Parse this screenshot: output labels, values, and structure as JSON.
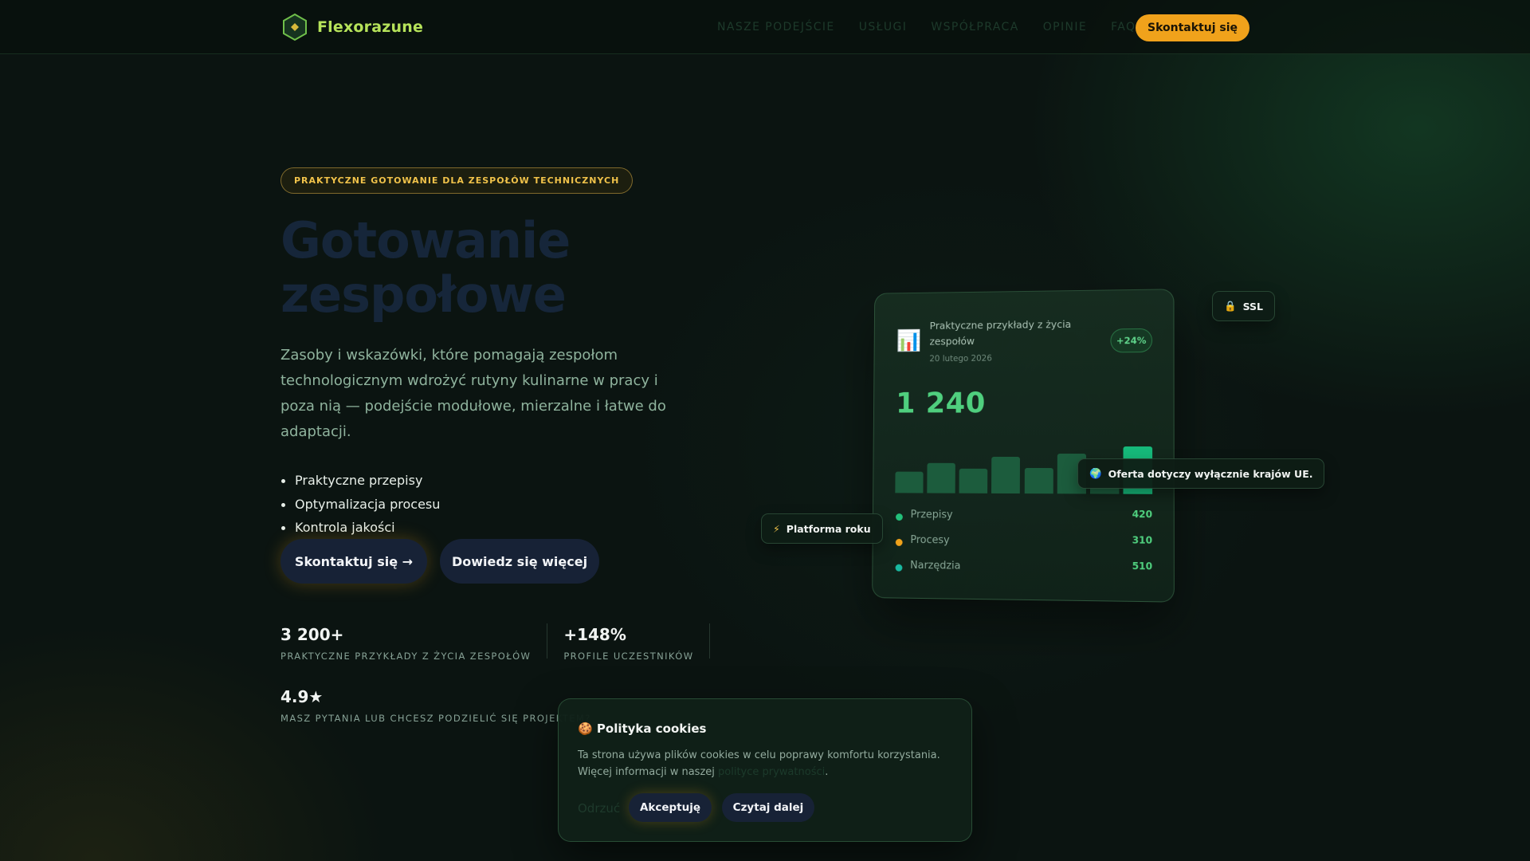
{
  "nav": {
    "logo_text": "Flexorazune",
    "links": [
      "NASZE PODEJŚCIE",
      "USŁUGI",
      "WSPÓŁPRACA",
      "OPINIE",
      "FAQ"
    ],
    "cta": "Skontaktuj się"
  },
  "hero": {
    "badge": "PRAKTYCZNE GOTOWANIE DLA ZESPOŁÓW TECHNICZNYCH",
    "title": "Gotowanie zespołowe",
    "subtitle": "Zasoby i wskazówki, które pomagają zespołom technologicznym wdrożyć rutyny kulinarne w pracy i poza nią — podejście modułowe, mierzalne i łatwe do adaptacji.",
    "bullets": [
      "Praktyczne przepisy",
      "Optymalizacja procesu",
      "Kontrola jakości"
    ],
    "primary_btn": "Skontaktuj się →",
    "secondary_btn": "Dowiedz się więcej"
  },
  "stats": [
    {
      "value": "3 200+",
      "label": "PRAKTYCZNE PRZYKŁADY Z ŻYCIA ZESPOŁÓW"
    },
    {
      "value": "+148%",
      "label": "PROFILE UCZESTNIKÓW"
    },
    {
      "value": "4.9★",
      "label": "MASZ PYTANIA LUB CHCESZ PODZIELIĆ SIĘ PROJEKTEM?"
    }
  ],
  "card": {
    "icon": "bar-chart-icon",
    "title": "Praktyczne przykłady z życia zespołów",
    "date": "20 lutego 2026",
    "pill": "+24%",
    "big_value": "1 240",
    "bar_levels": [
      0.42,
      0.6,
      0.48,
      0.72,
      0.5,
      0.78,
      0.35,
      0.92
    ],
    "bar_colors": {
      "normal": "#1c5c3d",
      "highlight": "#16b97a"
    },
    "legend": [
      {
        "label": "Przepisy",
        "value": "420",
        "color": "#23c07a"
      },
      {
        "label": "Procesy",
        "value": "310",
        "color": "#f0a21b"
      },
      {
        "label": "Narzędzia",
        "value": "510",
        "color": "#19b8a0"
      }
    ]
  },
  "chips": {
    "ssl": {
      "icon": "lock-icon",
      "text": "SSL"
    },
    "eu": {
      "icon": "globe-icon",
      "text": "Oferta dotyczy wyłącznie krajów UE."
    },
    "platform": {
      "icon": "lightning-icon",
      "text": "Platforma roku"
    }
  },
  "cookie": {
    "title": "🍪 Polityka cookies",
    "text_before": "Ta strona używa plików cookies w celu poprawy komfortu korzystania. Więcej informacji w naszej ",
    "link": "polityce prywatności",
    "text_after": ".",
    "reject": "Odrzuć",
    "accept": "Akceptuję",
    "more": "Czytaj dalej"
  },
  "colors": {
    "accent": "#f0a21b",
    "brand": "#b6e35a",
    "positive": "#4fcf7e"
  }
}
